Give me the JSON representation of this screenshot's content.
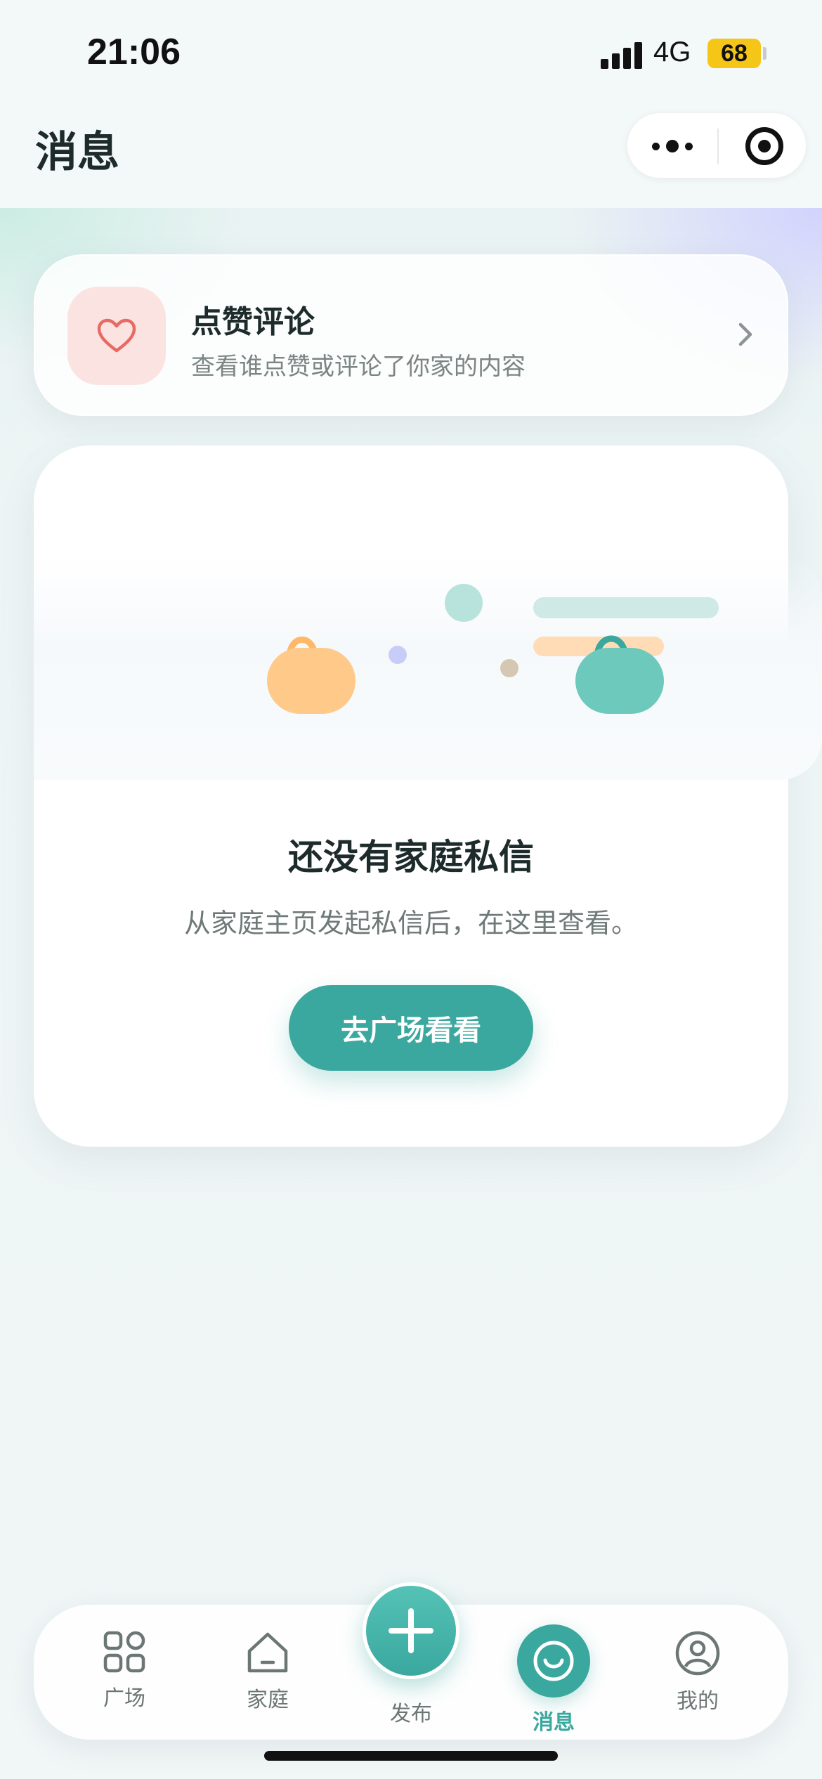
{
  "status_bar": {
    "time": "21:06",
    "network": "4G",
    "battery": "68"
  },
  "header": {
    "title": "消息"
  },
  "likes_card": {
    "title": "点赞评论",
    "subtitle": "查看谁点赞或评论了你家的内容",
    "icon": "heart-icon"
  },
  "empty_state": {
    "title": "还没有家庭私信",
    "subtitle": "从家庭主页发起私信后，在这里查看。",
    "button_label": "去广场看看"
  },
  "tabbar": {
    "items": [
      {
        "label": "广场",
        "icon": "grid-icon",
        "active": false
      },
      {
        "label": "家庭",
        "icon": "home-icon",
        "active": false
      },
      {
        "label": "发布",
        "icon": "plus-icon",
        "active": false
      },
      {
        "label": "消息",
        "icon": "smile-icon",
        "active": true
      },
      {
        "label": "我的",
        "icon": "user-icon",
        "active": false
      }
    ]
  },
  "colors": {
    "accent": "#3aa89e",
    "heart": "#e86a63",
    "heart_bg": "#fbe3e1",
    "bag_orange": "#ffc98a",
    "bag_teal": "#6ec9bd"
  }
}
